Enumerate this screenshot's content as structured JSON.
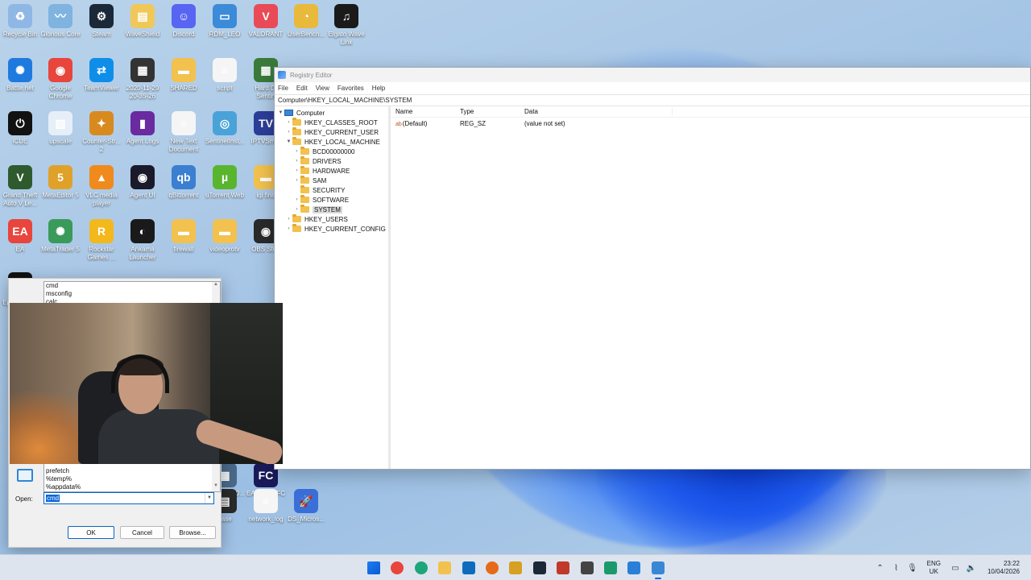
{
  "desktop": {
    "icons": [
      {
        "label": "Recycle Bin",
        "color": "#8fb7e6",
        "glyph": "♻"
      },
      {
        "label": "Glorious Core",
        "color": "#7fb3e0",
        "glyph": "〰"
      },
      {
        "label": "Steam",
        "color": "#1b2838",
        "glyph": "⚙"
      },
      {
        "label": "WaveShield",
        "color": "#f0c85a",
        "glyph": "▤"
      },
      {
        "label": "Discord",
        "color": "#5865f2",
        "glyph": "☺"
      },
      {
        "label": "RDM_LEO",
        "color": "#3b8bd8",
        "glyph": "▭"
      },
      {
        "label": "VALORANT",
        "color": "#e94a57",
        "glyph": "V"
      },
      {
        "label": "UserBench...",
        "color": "#e9b93b",
        "glyph": "◔"
      },
      {
        "label": "Elgato Wave Link",
        "color": "#1a1a1a",
        "glyph": "♫"
      },
      {
        "label": "Battle.net",
        "color": "#1f7ae0",
        "glyph": "✺"
      },
      {
        "label": "Google Chrome",
        "color": "#e8453c",
        "glyph": "◉"
      },
      {
        "label": "TeamViewer",
        "color": "#0e8ee9",
        "glyph": "⇄"
      },
      {
        "label": "2020-11-29 20-35-26",
        "color": "#333333",
        "glyph": "▦"
      },
      {
        "label": "SHARED",
        "color": "#f2c14e",
        "glyph": "▬"
      },
      {
        "label": "script",
        "color": "#f5f5f5",
        "glyph": "≡"
      },
      {
        "label": "Hard Di Sentin",
        "color": "#3a7a3a",
        "glyph": "▦"
      },
      {
        "label": "iCUE",
        "color": "#111111",
        "glyph": "⏻"
      },
      {
        "label": "upscale",
        "color": "#e6eef8",
        "glyph": "▨"
      },
      {
        "label": "Counter-Str... 2",
        "color": "#d98a1e",
        "glyph": "✦"
      },
      {
        "label": "Agent Logs",
        "color": "#6a2aa0",
        "glyph": "▮"
      },
      {
        "label": "New Text Document",
        "color": "#f5f5f5",
        "glyph": "≡"
      },
      {
        "label": "SentinelInst...",
        "color": "#4aa3d8",
        "glyph": "◎"
      },
      {
        "label": "IPTVSmar",
        "color": "#2d3e9a",
        "glyph": "TV"
      },
      {
        "label": "Grand Theft Auto V Le...",
        "color": "#2e5a2e",
        "glyph": "V"
      },
      {
        "label": "MetaEditor 5",
        "color": "#e0a12a",
        "glyph": "5"
      },
      {
        "label": "VLC media player",
        "color": "#f08a1c",
        "glyph": "▲"
      },
      {
        "label": "Agent UI",
        "color": "#1a1a2a",
        "glyph": "◉"
      },
      {
        "label": "qBittorrent",
        "color": "#3a7fd0",
        "glyph": "qb"
      },
      {
        "label": "uTorrent Web",
        "color": "#5ab52e",
        "glyph": "µ"
      },
      {
        "label": "iqi fina",
        "color": "#f2c14e",
        "glyph": "▬"
      },
      {
        "label": "EA",
        "color": "#e8453c",
        "glyph": "EA"
      },
      {
        "label": "MetaTrader 5",
        "color": "#3a9a5a",
        "glyph": "✺"
      },
      {
        "label": "Rockstar Games ...",
        "color": "#f2b81c",
        "glyph": "R"
      },
      {
        "label": "Ankama Launcher",
        "color": "#1a1a1a",
        "glyph": "◐"
      },
      {
        "label": "firewall",
        "color": "#f2c14e",
        "glyph": "▬"
      },
      {
        "label": "videoprotv",
        "color": "#f2c14e",
        "glyph": "▬"
      },
      {
        "label": "OBS Stud",
        "color": "#2a2a2a",
        "glyph": "◉"
      },
      {
        "label": "Epic Games",
        "color": "#111111",
        "glyph": "EPIC"
      },
      {
        "label": "Wald Bat 20...",
        "color": "#4a6a8a",
        "glyph": "▦"
      },
      {
        "label": "EA SPOR FC 26",
        "color": "#1a1a5a",
        "glyph": "FC"
      },
      {
        "label": "base",
        "color": "#2a2a2a",
        "glyph": "▤"
      },
      {
        "label": "network_log",
        "color": "#f5f5f5",
        "glyph": "≡"
      },
      {
        "label": "DS_Micros...",
        "color": "#3a6fd8",
        "glyph": "🚀"
      }
    ]
  },
  "regedit": {
    "title": "Registry Editor",
    "menu": [
      "File",
      "Edit",
      "View",
      "Favorites",
      "Help"
    ],
    "address": "Computer\\HKEY_LOCAL_MACHINE\\SYSTEM",
    "tree": [
      {
        "label": "Computer",
        "level": 0,
        "arrow": "▼",
        "kind": "pc"
      },
      {
        "label": "HKEY_CLASSES_ROOT",
        "level": 1,
        "arrow": "›",
        "kind": "folder"
      },
      {
        "label": "HKEY_CURRENT_USER",
        "level": 1,
        "arrow": "›",
        "kind": "folder"
      },
      {
        "label": "HKEY_LOCAL_MACHINE",
        "level": 1,
        "arrow": "▼",
        "kind": "folder"
      },
      {
        "label": "BCD00000000",
        "level": 2,
        "arrow": "›",
        "kind": "folder"
      },
      {
        "label": "DRIVERS",
        "level": 2,
        "arrow": "›",
        "kind": "folder"
      },
      {
        "label": "HARDWARE",
        "level": 2,
        "arrow": "›",
        "kind": "folder"
      },
      {
        "label": "SAM",
        "level": 2,
        "arrow": "›",
        "kind": "folder"
      },
      {
        "label": "SECURITY",
        "level": 2,
        "arrow": "",
        "kind": "folder"
      },
      {
        "label": "SOFTWARE",
        "level": 2,
        "arrow": "›",
        "kind": "folder"
      },
      {
        "label": "SYSTEM",
        "level": 2,
        "arrow": "›",
        "kind": "folder",
        "selected": true
      },
      {
        "label": "HKEY_USERS",
        "level": 1,
        "arrow": "›",
        "kind": "folder"
      },
      {
        "label": "HKEY_CURRENT_CONFIG",
        "level": 1,
        "arrow": "›",
        "kind": "folder"
      }
    ],
    "columns": {
      "name": "Name",
      "type": "Type",
      "data": "Data"
    },
    "values": [
      {
        "icon": "ab",
        "name": "(Default)",
        "type": "REG_SZ",
        "data": "(value not set)"
      }
    ]
  },
  "run_dialog": {
    "history_top": [
      "cmd",
      "msconfig",
      "calc"
    ],
    "history_bottom": [
      "prefetch",
      "%temp%",
      "%appdata%"
    ],
    "open_label": "Open:",
    "input_value": "cmd",
    "ok_label": "OK",
    "cancel_label": "Cancel",
    "browse_label": "Browse..."
  },
  "taskbar": {
    "icons": [
      {
        "name": "start-icon",
        "color": "#0a64d8"
      },
      {
        "name": "chrome-icon",
        "color": "#e8453c"
      },
      {
        "name": "edge-icon",
        "color": "#1fa57a"
      },
      {
        "name": "file-explorer-icon",
        "color": "#f2c14e"
      },
      {
        "name": "outlook-icon",
        "color": "#0f6cbd"
      },
      {
        "name": "firefox-icon",
        "color": "#e66a1a"
      },
      {
        "name": "metaeditor-icon",
        "color": "#d8a020"
      },
      {
        "name": "steam-icon",
        "color": "#1b2838"
      },
      {
        "name": "acrobat-icon",
        "color": "#c0392b"
      },
      {
        "name": "activity-icon",
        "color": "#444444"
      },
      {
        "name": "app-green-icon",
        "color": "#1a9a6a"
      },
      {
        "name": "app-blue-icon",
        "color": "#2a7fd8"
      },
      {
        "name": "regedit-taskbar-icon",
        "color": "#3a86d6"
      }
    ],
    "lang_top": "ENG",
    "lang_bottom": "UK",
    "time": "23:22",
    "date": "10/04/2026"
  }
}
